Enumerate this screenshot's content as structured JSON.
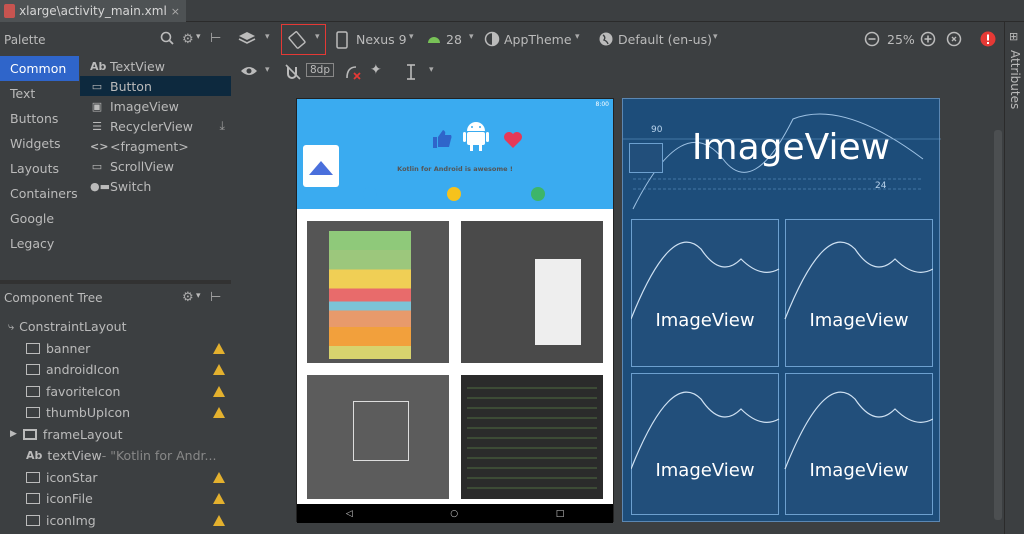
{
  "tab": {
    "title": "xlarge\\activity_main.xml",
    "close": "×"
  },
  "palette": {
    "title": "Palette",
    "categories": [
      "Common",
      "Text",
      "Buttons",
      "Widgets",
      "Layouts",
      "Containers",
      "Google",
      "Legacy"
    ],
    "selected_category": "Common",
    "items": [
      {
        "icon": "Ab",
        "label": "TextView"
      },
      {
        "icon": "▭",
        "label": "Button"
      },
      {
        "icon": "▣",
        "label": "ImageView"
      },
      {
        "icon": "☰",
        "label": "RecyclerView"
      },
      {
        "icon": "<>",
        "label": "<fragment>"
      },
      {
        "icon": "▭",
        "label": "ScrollView"
      },
      {
        "icon": "●▬",
        "label": "Switch"
      }
    ]
  },
  "component_tree": {
    "title": "Component Tree",
    "root": "ConstraintLayout",
    "nodes": [
      {
        "label": "banner",
        "extra": "",
        "warning": true
      },
      {
        "label": "androidIcon",
        "extra": "",
        "warning": true
      },
      {
        "label": "favoriteIcon",
        "extra": "",
        "warning": true
      },
      {
        "label": "thumbUpIcon",
        "extra": "",
        "warning": true
      },
      {
        "label": "frameLayout",
        "extra": "",
        "warning": false
      },
      {
        "label": "textView",
        "extra": "- \"Kotlin for Andr...",
        "warning": false
      },
      {
        "label": "iconStar",
        "extra": "",
        "warning": true
      },
      {
        "label": "iconFile",
        "extra": "",
        "warning": true
      },
      {
        "label": "iconImg",
        "extra": "",
        "warning": true
      }
    ]
  },
  "toolbar": {
    "device": "Nexus 9",
    "api": "28",
    "theme": "AppTheme",
    "locale": "Default (en-us)",
    "zoom": "25%",
    "margin": "8dp"
  },
  "phone": {
    "status": "8:00",
    "headline": "Kotlin for Android is awesome !"
  },
  "blueprint": {
    "big_label": "ImageView",
    "grid_labels": [
      "ImageView",
      "ImageView",
      "ImageView",
      "ImageView"
    ],
    "dims": [
      "90",
      "24"
    ]
  },
  "attributes": {
    "label": "Attributes"
  },
  "colors": {
    "accent": "#2f65ca",
    "warning": "#e4b12e",
    "highlight": "#e53935",
    "blueprint": "#1d4d7a"
  }
}
